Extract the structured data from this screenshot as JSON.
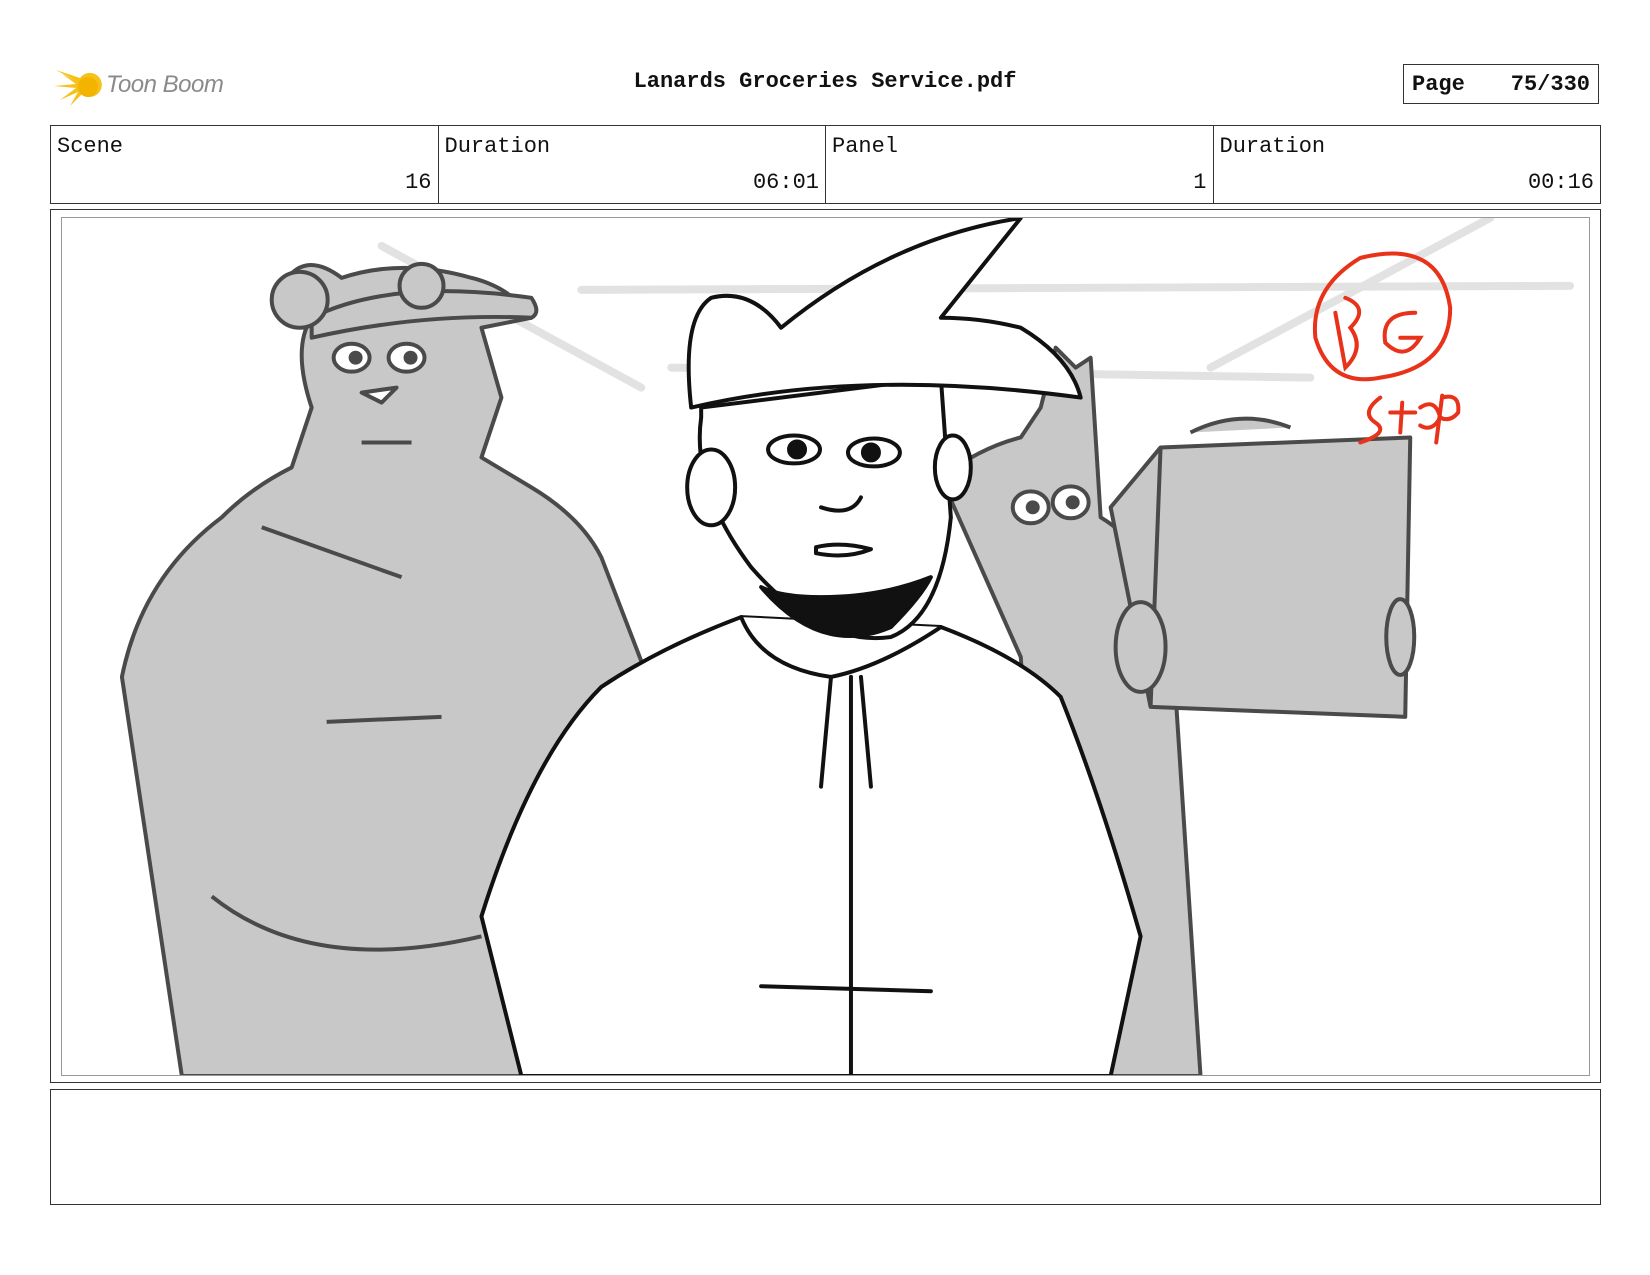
{
  "header": {
    "logo_text": "Toon Boom",
    "title": "Lanards Groceries Service.pdf",
    "page_label": "Page",
    "page_value": "75/330"
  },
  "info": {
    "scene_label": "Scene",
    "scene_value": "16",
    "scene_duration_label": "Duration",
    "scene_duration_value": "06:01",
    "panel_label": "Panel",
    "panel_value": "1",
    "panel_duration_label": "Duration",
    "panel_duration_value": "00:16"
  },
  "panel": {
    "annotation": "BG STOP",
    "annotation_color": "#e8321a"
  },
  "caption": {
    "text": ""
  },
  "colors": {
    "logo_yellow": "#f6c21a",
    "sketch_gray": "#c8c8c8",
    "sketch_line": "#4a4a4a"
  }
}
